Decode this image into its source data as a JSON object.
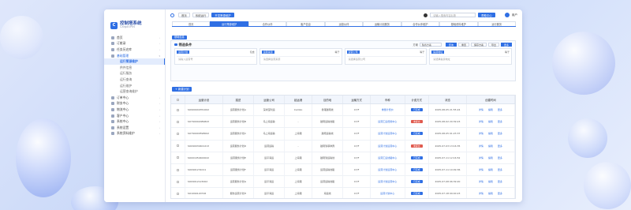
{
  "app": {
    "name": "控制塔系统",
    "subtitle": "CargoOPIN",
    "logo_letter": "C"
  },
  "sidebar": {
    "items": [
      {
        "label": "首页",
        "kind": "top"
      },
      {
        "label": "订舱录",
        "kind": "top"
      },
      {
        "label": "任务历史库",
        "kind": "top"
      },
      {
        "label": "基础管理",
        "kind": "open"
      },
      {
        "label": "运行策源维护",
        "kind": "active"
      },
      {
        "label": "供件信息",
        "kind": "sub"
      },
      {
        "label": "运行服务",
        "kind": "sub"
      },
      {
        "label": "运行查询",
        "kind": "sub"
      },
      {
        "label": "运行维护",
        "kind": "sub"
      },
      {
        "label": "运营查询维护",
        "kind": "sub"
      },
      {
        "label": "订单中心",
        "kind": "top"
      },
      {
        "label": "财务中心",
        "kind": "top"
      },
      {
        "label": "物流中心",
        "kind": "top"
      },
      {
        "label": "客户中心",
        "kind": "top"
      },
      {
        "label": "系统中心",
        "kind": "top"
      },
      {
        "label": "系统设置",
        "kind": "top"
      },
      {
        "label": "系统资料维护",
        "kind": "top"
      }
    ]
  },
  "topbar": {
    "buttons": [
      "首页",
      "系统运行",
      "开发策源维护"
    ],
    "search_placeholder": "请输入搜索内容后按",
    "help_label": "帮助中心",
    "user_name": "用户"
  },
  "tabs": [
    {
      "label": "首页",
      "active": false
    },
    {
      "label": "运行策源维护",
      "active": true
    },
    {
      "label": "合作伙伴",
      "active": false
    },
    {
      "label": "客户信息",
      "active": false
    },
    {
      "label": "运营伙伴",
      "active": false
    },
    {
      "label": "运输计划服务",
      "active": false
    },
    {
      "label": "合作伙伴维护",
      "active": false
    },
    {
      "label": "基础资料维护",
      "active": false
    },
    {
      "label": "运行服务",
      "active": false
    }
  ],
  "section_label": "基础信息",
  "filter": {
    "title": "筛选条件",
    "type_label": "方案",
    "type_value": "缺省方案",
    "buttons": {
      "search": "查询",
      "reset": "重置",
      "save": "保存方案",
      "export": "导出",
      "more": "更多"
    },
    "fields": [
      {
        "tag": "运营计划",
        "op": "包含",
        "placeholder": "请输入运营号"
      },
      {
        "tag": "运营来源",
        "op": "等于",
        "placeholder": "请选择运营来源"
      },
      {
        "tag": "运营公司",
        "op": "等于",
        "placeholder": "请选择运营公司"
      },
      {
        "tag": "提货地址",
        "op": "等于",
        "placeholder": "请选择提货地址"
      }
    ]
  },
  "add_button": "+ 新建计划",
  "table": {
    "columns": [
      "",
      "运营计划",
      "描述",
      "运营公司",
      "起运港",
      "目的地",
      "运输方式",
      "币种",
      "计费方式",
      "状态",
      "创建时间",
      "操作"
    ],
    "rows": [
      {
        "code": "SO900040351002",
        "desc": "运营服务计划A",
        "company": "深圳宝利运",
        "from": "Cambo",
        "to": "香港越南线",
        "mode": "CY/F",
        "fee": "重量计费价",
        "status": "已完成",
        "status_type": "blue",
        "time": "2025-08-05 21:55:24"
      },
      {
        "code": "SO790002089843",
        "desc": "运营服务计划B",
        "company": "马上海运输",
        "from": "-",
        "to": "越南运输线路",
        "mode": "CY/F",
        "fee": "运营汇运费用中心",
        "status": "未提交",
        "status_type": "red",
        "time": "2025-08-02 20:39:23"
      },
      {
        "code": "SO790000598002",
        "desc": "运营服务计划C",
        "company": "马上海运输",
        "from": "上海港",
        "to": "越南运输线",
        "mode": "CY/F",
        "fee": "运营计划运营中心",
        "status": "已完成",
        "status_type": "blue",
        "time": "2025-08-05 01:23:37"
      },
      {
        "code": "SO090030401213",
        "desc": "运营服务计划D",
        "company": "运营运输",
        "from": "-",
        "to": "越南到菲律宾",
        "mode": "CY/F",
        "fee": "运营计划运营中心",
        "status": "未提交",
        "status_type": "red",
        "time": "2025-07-03 13:16:35"
      },
      {
        "code": "SO001050400022",
        "desc": "运营服务计划E",
        "company": "运平海运",
        "from": "上海港",
        "to": "越南到运输线",
        "mode": "CY/F",
        "fee": "运营汇运线路中心",
        "status": "已完成",
        "status_type": "blue",
        "time": "2025-07-11 12:16:52"
      },
      {
        "code": "SO0901231011",
        "desc": "运营服务计划F",
        "company": "运平海运",
        "from": "上海港",
        "to": "运营运输线路",
        "mode": "CY/F",
        "fee": "运营计划运营中心",
        "status": "已完成",
        "status_type": "blue",
        "time": "2025-07-11 10:09:36"
      },
      {
        "code": "SO09012123002",
        "desc": "运营服务计划G",
        "company": "运平海运",
        "from": "上海港",
        "to": "运营运输线路",
        "mode": "CY/F",
        "fee": "运营计划运营中心",
        "status": "已完成",
        "status_type": "blue",
        "time": "2025-07-08 06:39:20"
      },
      {
        "code": "SO1090120726",
        "desc": "服务运营计划H",
        "company": "运平海运",
        "from": "上海港",
        "to": "海运线",
        "mode": "CY/F",
        "fee": "运营计划中心",
        "status": "已完成",
        "status_type": "blue",
        "time": "2025-07-18 09:40:23"
      }
    ],
    "actions": [
      "详情",
      "编辑",
      "更多"
    ]
  },
  "colors": {
    "primary": "#2f6fe4",
    "danger": "#e05a4e"
  }
}
